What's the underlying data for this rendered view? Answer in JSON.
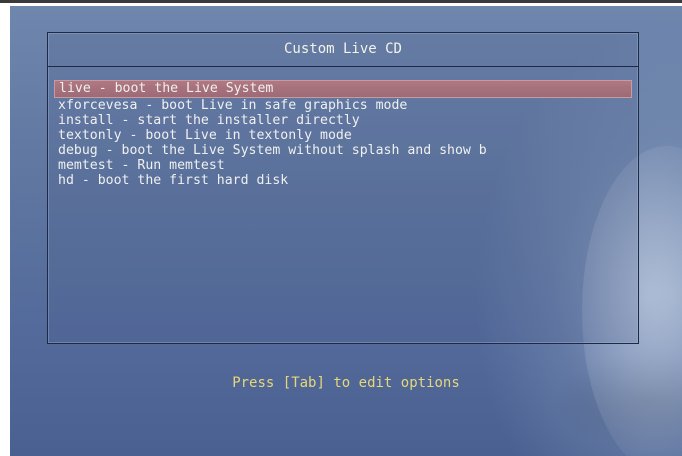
{
  "menu": {
    "title": "Custom Live CD",
    "items": [
      {
        "label": "live - boot the Live System",
        "selected": true
      },
      {
        "label": "xforcevesa - boot Live in safe graphics mode",
        "selected": false
      },
      {
        "label": "install - start the installer directly",
        "selected": false
      },
      {
        "label": "textonly - boot Live in textonly mode",
        "selected": false
      },
      {
        "label": "debug - boot the Live System without splash and show b",
        "selected": false
      },
      {
        "label": "memtest - Run memtest",
        "selected": false
      },
      {
        "label": "hd - boot the first hard disk",
        "selected": false
      }
    ]
  },
  "hint": "Press [Tab] to edit options",
  "colors": {
    "background": "#5e76a0",
    "selection": "#a36f7b",
    "menu_text": "#f0f0f0",
    "hint_text": "#e6d87a"
  }
}
